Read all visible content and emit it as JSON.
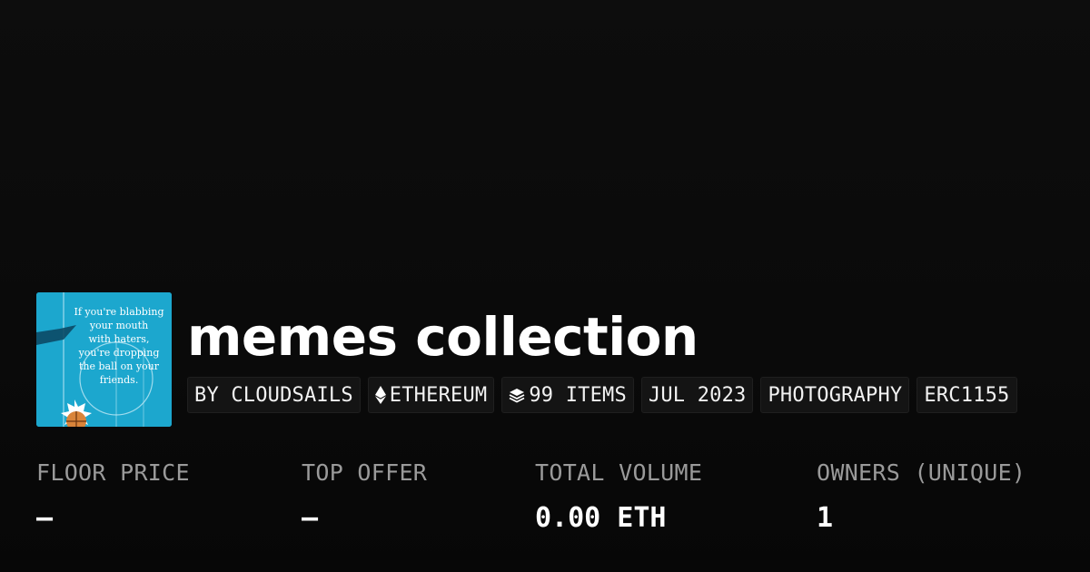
{
  "collection": {
    "title": "memes collection",
    "thumbnail": {
      "caption": "If you're blabbing\nyour mouth\nwith haters,\nyou're dropping\nthe ball on your\nfriends.",
      "background": "#1aa1c9"
    }
  },
  "tags": [
    {
      "label": "BY CLOUDSAILS",
      "icon": ""
    },
    {
      "label": "ETHEREUM",
      "icon": "ethereum-icon"
    },
    {
      "label": "99 ITEMS",
      "icon": "layers-icon"
    },
    {
      "label": "JUL 2023",
      "icon": ""
    },
    {
      "label": "PHOTOGRAPHY",
      "icon": ""
    },
    {
      "label": "ERC1155",
      "icon": ""
    }
  ],
  "stats": [
    {
      "label": "FLOOR PRICE",
      "value": "—"
    },
    {
      "label": "TOP OFFER",
      "value": "—"
    },
    {
      "label": "TOTAL VOLUME",
      "value": "0.00 ETH"
    },
    {
      "label": "OWNERS (UNIQUE)",
      "value": "1"
    }
  ],
  "colors": {
    "background": "#0b0b0b",
    "tag_background": "#141414",
    "label_gray": "#9a9a9a",
    "text_white": "#ffffff"
  }
}
